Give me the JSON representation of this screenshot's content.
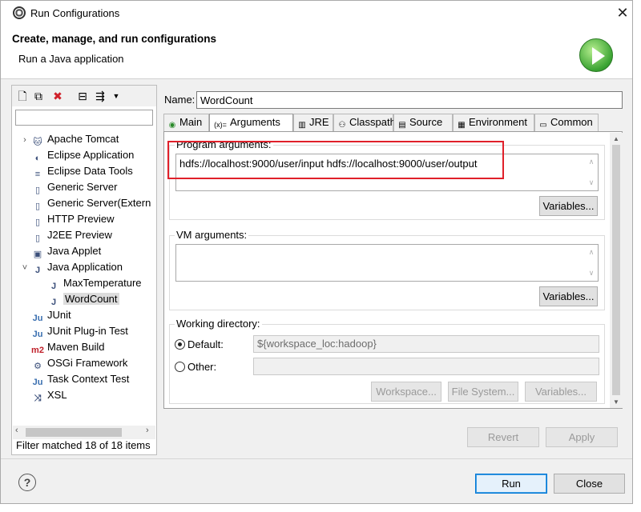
{
  "window": {
    "title": "Run Configurations"
  },
  "banner": {
    "heading": "Create, manage, and run configurations",
    "subtitle": "Run a Java application"
  },
  "left": {
    "filter_placeholder": "",
    "tree": [
      {
        "label": "Apache Tomcat",
        "level": 0,
        "expander": "›",
        "icon": "tomcat-icon",
        "glyph": "🐱"
      },
      {
        "label": "Eclipse Application",
        "level": 0,
        "expander": "",
        "icon": "eclipse-icon",
        "glyph": "◐"
      },
      {
        "label": "Eclipse Data Tools",
        "level": 0,
        "expander": "",
        "icon": "database-icon",
        "glyph": "≡"
      },
      {
        "label": "Generic Server",
        "level": 0,
        "expander": "",
        "icon": "server-icon",
        "glyph": "▯"
      },
      {
        "label": "Generic Server(Extern",
        "level": 0,
        "expander": "",
        "icon": "server-icon",
        "glyph": "▯"
      },
      {
        "label": "HTTP Preview",
        "level": 0,
        "expander": "",
        "icon": "preview-icon",
        "glyph": "▯"
      },
      {
        "label": "J2EE Preview",
        "level": 0,
        "expander": "",
        "icon": "preview-icon",
        "glyph": "▯"
      },
      {
        "label": "Java Applet",
        "level": 0,
        "expander": "",
        "icon": "applet-icon",
        "glyph": "▣"
      },
      {
        "label": "Java Application",
        "level": 0,
        "expander": "˅",
        "icon": "java-app-icon",
        "glyph": "J"
      },
      {
        "label": "MaxTemperature",
        "level": 1,
        "expander": "",
        "icon": "java-app-icon",
        "glyph": "J"
      },
      {
        "label": "WordCount",
        "level": 1,
        "expander": "",
        "icon": "java-app-icon",
        "glyph": "J",
        "selected": true
      },
      {
        "label": "JUnit",
        "level": 0,
        "expander": "",
        "icon": "junit-icon",
        "glyph": "Ju"
      },
      {
        "label": "JUnit Plug-in Test",
        "level": 0,
        "expander": "",
        "icon": "junit-plugin-icon",
        "glyph": "Ju"
      },
      {
        "label": "Maven Build",
        "level": 0,
        "expander": "",
        "icon": "maven-icon",
        "glyph": "m2"
      },
      {
        "label": "OSGi Framework",
        "level": 0,
        "expander": "",
        "icon": "osgi-icon",
        "glyph": "⚙"
      },
      {
        "label": "Task Context Test",
        "level": 0,
        "expander": "",
        "icon": "task-test-icon",
        "glyph": "Ju"
      },
      {
        "label": "XSL",
        "level": 0,
        "expander": "",
        "icon": "xsl-icon",
        "glyph": "⤨"
      }
    ],
    "status": "Filter matched 18 of 18 items"
  },
  "config": {
    "name_label": "Name:",
    "name_value": "WordCount",
    "tabs": [
      {
        "label": "Main",
        "icon": "main-tab-icon",
        "glyph": "◉"
      },
      {
        "label": "Arguments",
        "icon": "arguments-tab-icon",
        "glyph": "(x)=",
        "active": true
      },
      {
        "label": "JRE",
        "icon": "jre-tab-icon",
        "glyph": "▥"
      },
      {
        "label": "Classpath",
        "icon": "classpath-tab-icon",
        "glyph": "⚇"
      },
      {
        "label": "Source",
        "icon": "source-tab-icon",
        "glyph": "▤"
      },
      {
        "label": "Environment",
        "icon": "environment-tab-icon",
        "glyph": "▦"
      },
      {
        "label": "Common",
        "icon": "common-tab-icon",
        "glyph": "▭"
      }
    ],
    "program_args_label": "Program arguments:",
    "program_args_value": "hdfs://localhost:9000/user/input hdfs://localhost:9000/user/output",
    "vm_args_label": "VM arguments:",
    "vm_args_value": "",
    "variables_label": "Variables...",
    "workdir_label": "Working directory:",
    "default_label": "Default:",
    "default_value": "${workspace_loc:hadoop}",
    "other_label": "Other:",
    "workspace_btn": "Workspace...",
    "filesystem_btn": "File System...",
    "variables_btn2": "Variables..."
  },
  "actions": {
    "revert": "Revert",
    "apply": "Apply",
    "run": "Run",
    "close": "Close"
  },
  "colors": {
    "highlight": "#e0202a",
    "accent": "#0078d7"
  }
}
